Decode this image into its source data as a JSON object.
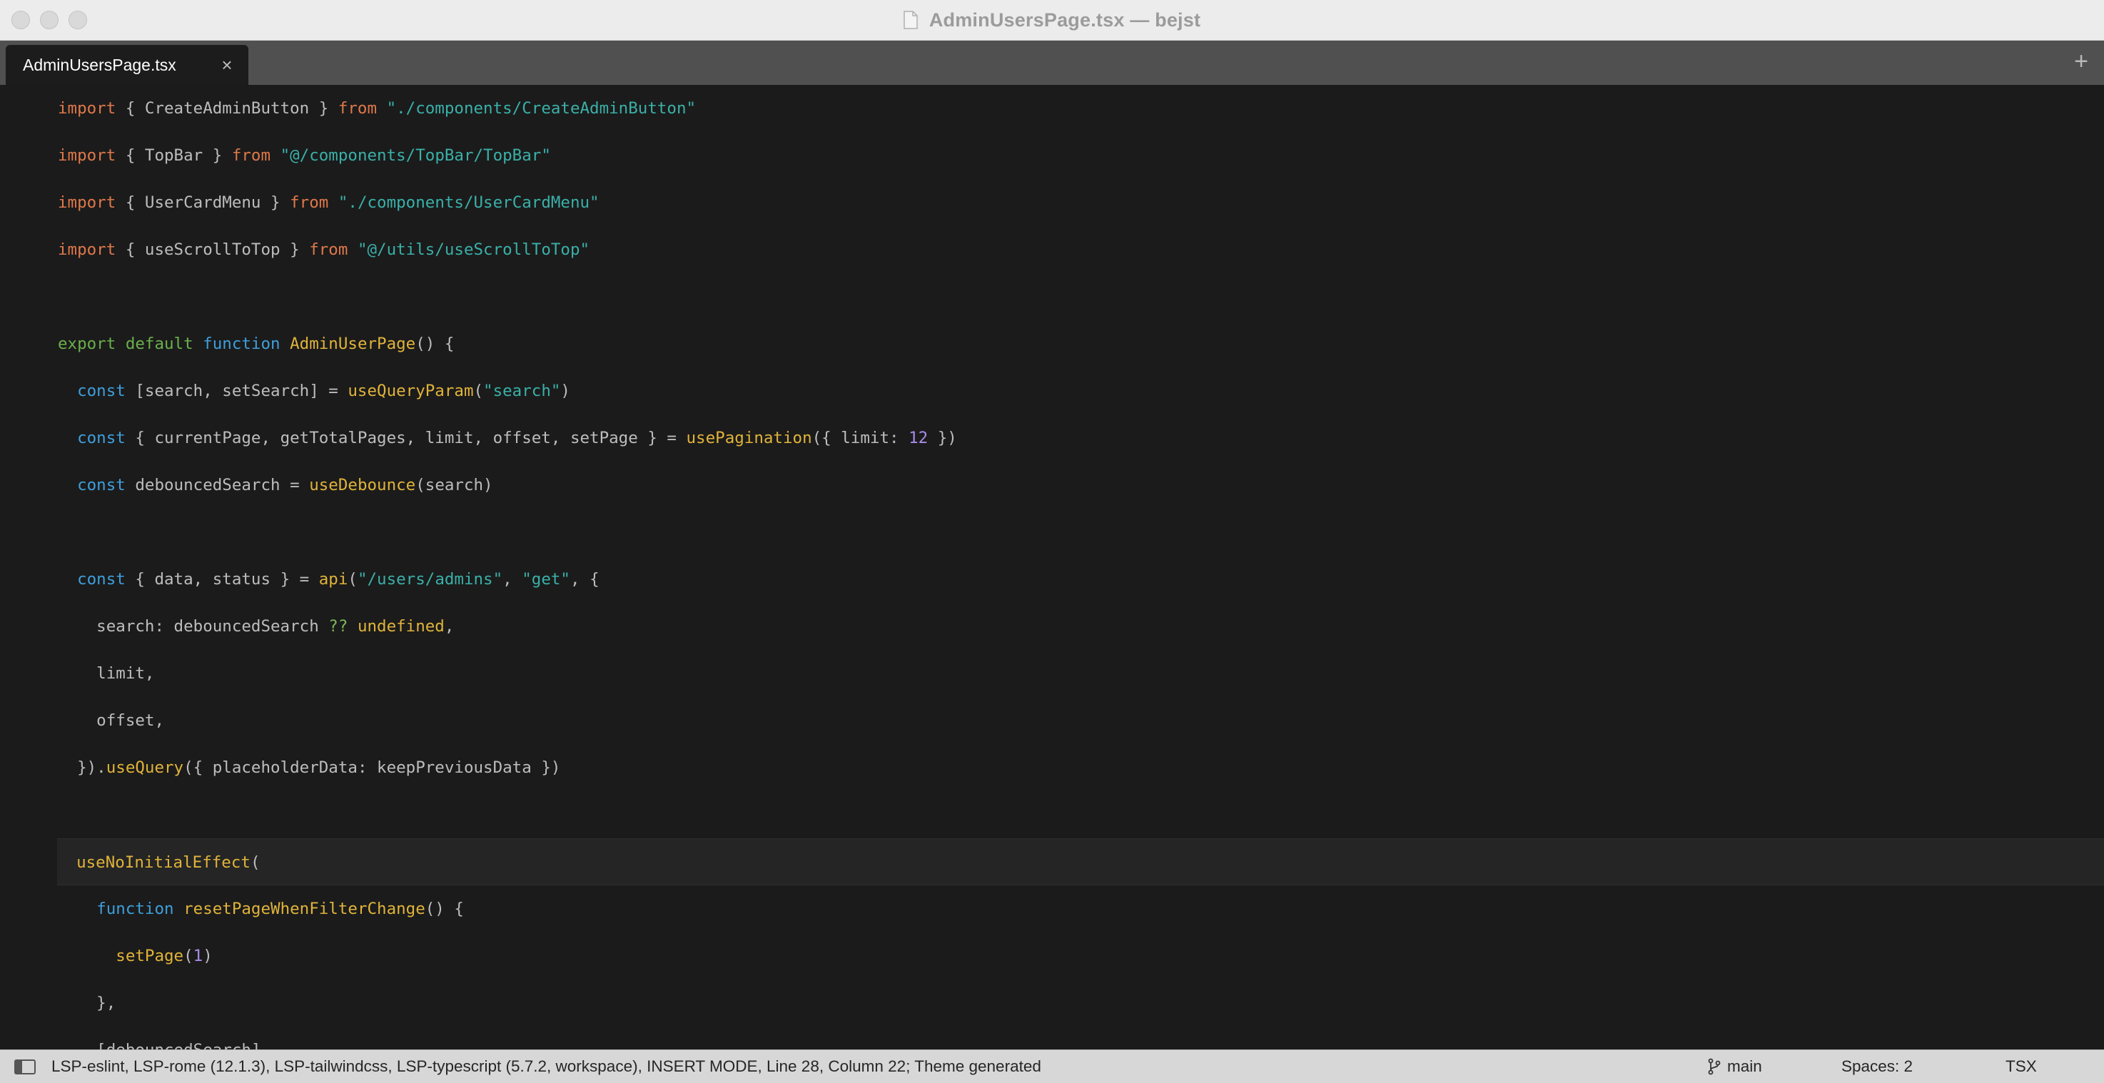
{
  "window": {
    "title": "AdminUsersPage.tsx — bejst"
  },
  "tabs": [
    {
      "label": "AdminUsersPage.tsx",
      "active": true
    }
  ],
  "icons": {
    "tab_close": "×",
    "new_tab": "+"
  },
  "editor": {
    "current_line_index": 16,
    "lines": [
      [
        [
          "kw",
          "import"
        ],
        [
          "def",
          " { CreateAdminButton } "
        ],
        [
          "kw",
          "from"
        ],
        [
          "def",
          " "
        ],
        [
          "str",
          "\"./components/CreateAdminButton\""
        ]
      ],
      [
        [
          "kw",
          "import"
        ],
        [
          "def",
          " { TopBar } "
        ],
        [
          "kw",
          "from"
        ],
        [
          "def",
          " "
        ],
        [
          "str",
          "\"@/components/TopBar/TopBar\""
        ]
      ],
      [
        [
          "kw",
          "import"
        ],
        [
          "def",
          " { UserCardMenu } "
        ],
        [
          "kw",
          "from"
        ],
        [
          "def",
          " "
        ],
        [
          "str",
          "\"./components/UserCardMenu\""
        ]
      ],
      [
        [
          "kw",
          "import"
        ],
        [
          "def",
          " { useScrollToTop } "
        ],
        [
          "kw",
          "from"
        ],
        [
          "def",
          " "
        ],
        [
          "str",
          "\"@/utils/useScrollToTop\""
        ]
      ],
      [],
      [
        [
          "ex",
          "export"
        ],
        [
          "def",
          " "
        ],
        [
          "ex",
          "default"
        ],
        [
          "def",
          " "
        ],
        [
          "kw2",
          "function"
        ],
        [
          "def",
          " "
        ],
        [
          "fn",
          "AdminUserPage"
        ],
        [
          "def",
          "() {"
        ]
      ],
      [
        [
          "def",
          "  "
        ],
        [
          "kw2",
          "const"
        ],
        [
          "def",
          " [search, setSearch] = "
        ],
        [
          "fn",
          "useQueryParam"
        ],
        [
          "def",
          "("
        ],
        [
          "str",
          "\"search\""
        ],
        [
          "def",
          ")"
        ]
      ],
      [
        [
          "def",
          "  "
        ],
        [
          "kw2",
          "const"
        ],
        [
          "def",
          " { currentPage, getTotalPages, limit, offset, setPage } = "
        ],
        [
          "fn",
          "usePagination"
        ],
        [
          "def",
          "({ limit: "
        ],
        [
          "num",
          "12"
        ],
        [
          "def",
          " })"
        ]
      ],
      [
        [
          "def",
          "  "
        ],
        [
          "kw2",
          "const"
        ],
        [
          "def",
          " debouncedSearch = "
        ],
        [
          "fn",
          "useDebounce"
        ],
        [
          "def",
          "(search)"
        ]
      ],
      [],
      [
        [
          "def",
          "  "
        ],
        [
          "kw2",
          "const"
        ],
        [
          "def",
          " { data, status } = "
        ],
        [
          "fn",
          "api"
        ],
        [
          "def",
          "("
        ],
        [
          "str",
          "\"/users/admins\""
        ],
        [
          "def",
          ", "
        ],
        [
          "str",
          "\"get\""
        ],
        [
          "def",
          ", {"
        ]
      ],
      [
        [
          "def",
          "    search: debouncedSearch "
        ],
        [
          "op",
          "??"
        ],
        [
          "def",
          " "
        ],
        [
          "und",
          "undefined"
        ],
        [
          "def",
          ","
        ]
      ],
      [
        [
          "def",
          "    limit,"
        ]
      ],
      [
        [
          "def",
          "    offset,"
        ]
      ],
      [
        [
          "def",
          "  })."
        ],
        [
          "fn",
          "useQuery"
        ],
        [
          "def",
          "({ placeholderData: keepPreviousData })"
        ]
      ],
      [],
      [
        [
          "def",
          "  "
        ],
        [
          "fn",
          "useNoInitialEffect"
        ],
        [
          "def",
          "("
        ]
      ],
      [
        [
          "def",
          "    "
        ],
        [
          "kw2",
          "function"
        ],
        [
          "def",
          " "
        ],
        [
          "fn",
          "resetPageWhenFilterChange"
        ],
        [
          "def",
          "() {"
        ]
      ],
      [
        [
          "def",
          "      "
        ],
        [
          "fn",
          "setPage"
        ],
        [
          "def",
          "("
        ],
        [
          "num",
          "1"
        ],
        [
          "def",
          ")"
        ]
      ],
      [
        [
          "def",
          "    },"
        ]
      ],
      [
        [
          "def",
          "    [debouncedSearch],"
        ]
      ]
    ]
  },
  "statusbar": {
    "info": "LSP-eslint, LSP-rome (12.1.3), LSP-tailwindcss, LSP-typescript (5.7.2, workspace), INSERT MODE, Line 28, Column 22; Theme generated",
    "branch": "main",
    "spaces": "Spaces: 2",
    "syntax": "TSX"
  }
}
